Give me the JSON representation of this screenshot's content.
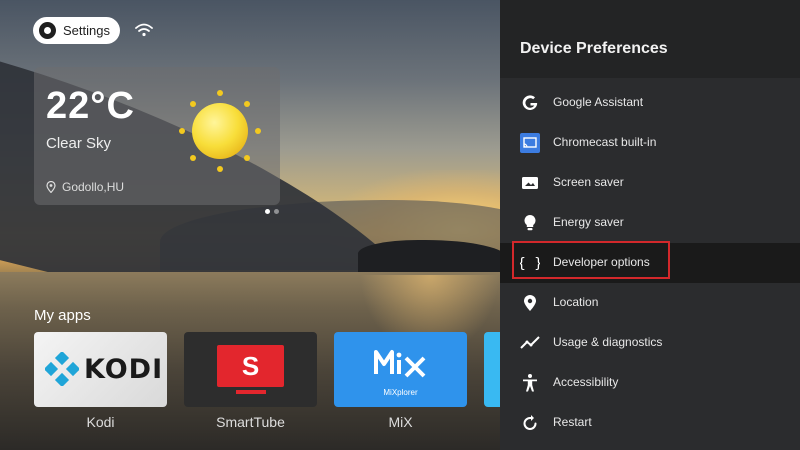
{
  "topbar": {
    "settings_label": "Settings",
    "settings_icon": "gear-icon",
    "wifi_icon": "wifi-icon"
  },
  "weather": {
    "temperature": "22°C",
    "condition": "Clear Sky",
    "location": "Godollo,HU"
  },
  "apps": {
    "title": "My apps",
    "items": [
      {
        "name": "Kodi",
        "logo_text": "KODI"
      },
      {
        "name": "SmartTube",
        "logo_text": "S"
      },
      {
        "name": "MiX",
        "logo_text": "MiXplorer"
      }
    ]
  },
  "panel": {
    "title": "Device Preferences",
    "focused_index": 4,
    "accent_color": "#d3282b",
    "items": [
      {
        "label": "Google Assistant",
        "icon": "google-icon"
      },
      {
        "label": "Chromecast built-in",
        "icon": "cast-icon"
      },
      {
        "label": "Screen saver",
        "icon": "screensaver-icon"
      },
      {
        "label": "Energy saver",
        "icon": "lightbulb-icon"
      },
      {
        "label": "Developer options",
        "icon": "braces-icon"
      },
      {
        "label": "Location",
        "icon": "location-pin-icon"
      },
      {
        "label": "Usage & diagnostics",
        "icon": "trend-icon"
      },
      {
        "label": "Accessibility",
        "icon": "accessibility-icon"
      },
      {
        "label": "Restart",
        "icon": "restart-icon"
      }
    ]
  }
}
